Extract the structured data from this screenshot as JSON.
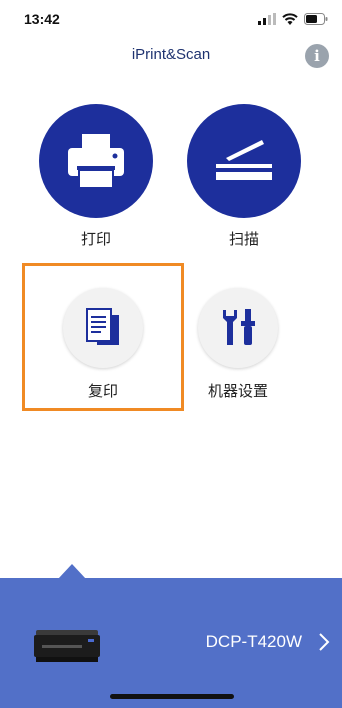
{
  "status_bar": {
    "time": "13:42"
  },
  "header": {
    "title": "iPrint&Scan",
    "info_icon": "info-icon",
    "info_glyph": "i"
  },
  "actions": {
    "print": {
      "label": "打印",
      "icon": "printer-icon"
    },
    "scan": {
      "label": "扫描",
      "icon": "scanner-icon"
    },
    "copy": {
      "label": "复印",
      "icon": "copy-document-icon"
    },
    "settings": {
      "label": "机器设置",
      "icon": "tools-icon"
    }
  },
  "device": {
    "name": "DCP-T420W",
    "icon": "printer-thumbnail",
    "chevron": "chevron-right-icon"
  },
  "colors": {
    "primary": "#1d2f9c",
    "device_bar": "#5270c8",
    "highlight": "#f08a24",
    "title": "#1f3370"
  }
}
